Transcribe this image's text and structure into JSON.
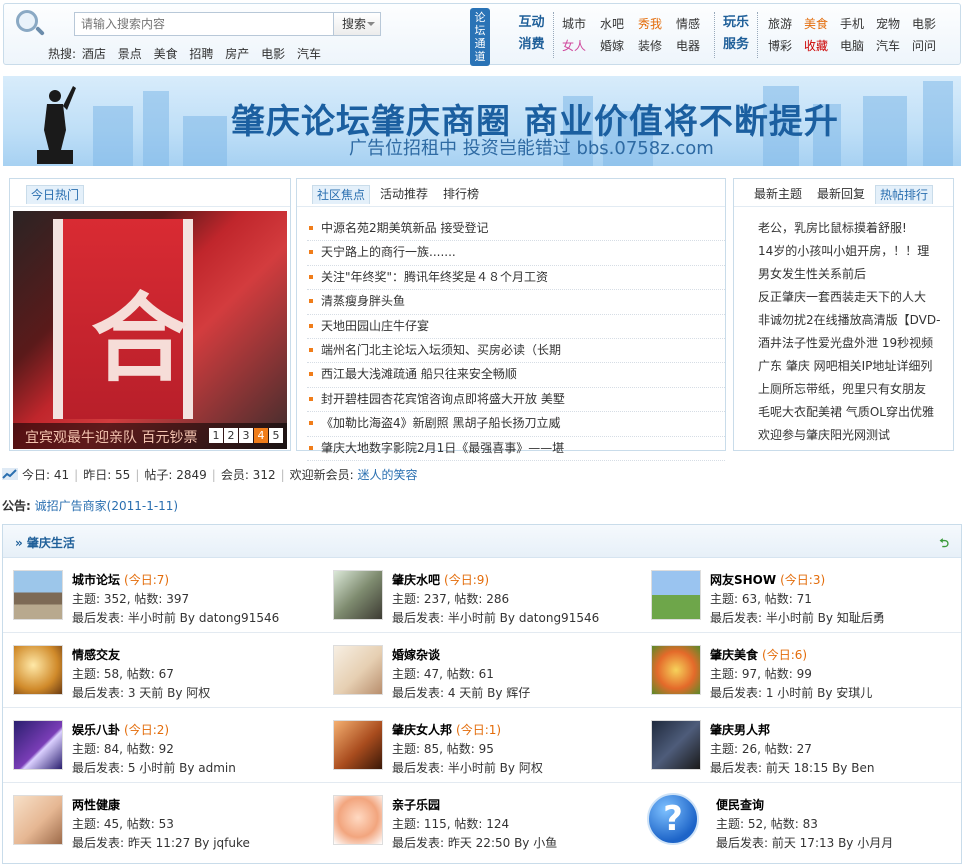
{
  "search": {
    "placeholder": "请输入搜索内容",
    "button": "搜索",
    "hot_label": "热搜:",
    "hot_words": [
      "酒店",
      "景点",
      "美食",
      "招聘",
      "房产",
      "电影",
      "汽车"
    ]
  },
  "channel": {
    "badge": "论坛通道",
    "group1": {
      "cat1": "互动",
      "cat2": "消费",
      "row1": [
        "城市",
        "水吧",
        "秀我",
        "情感"
      ],
      "row2": [
        "女人",
        "婚嫁",
        "装修",
        "电器"
      ]
    },
    "group2": {
      "cat1": "玩乐",
      "cat2": "服务",
      "row1": [
        "旅游",
        "美食",
        "手机",
        "宠物",
        "电影"
      ],
      "row2": [
        "博彩",
        "收藏",
        "电脑",
        "汽车",
        "问问"
      ]
    }
  },
  "banner": {
    "title": "肇庆论坛肇庆商圈 商业价值将不断提升",
    "subtitle": "广告位招租中  投资岂能错过  bbs.0758z.com"
  },
  "panel_left": {
    "tab": "今日热门",
    "photo_char": "合",
    "caption": "宜宾观最牛迎亲队 百元钞票",
    "pages": [
      "1",
      "2",
      "3",
      "4",
      "5"
    ],
    "active_page": "4"
  },
  "panel_mid": {
    "tabs": [
      "社区焦点",
      "活动推荐",
      "排行榜"
    ],
    "news": [
      "中源名苑2期美筑新品 接受登记",
      "天宁路上的商行一族.......",
      "关注\"年终奖\"：腾讯年终奖是４８个月工资",
      "清蒸瘦身胖头鱼",
      "天地田园山庄牛仔宴",
      "端州名门北主论坛入坛须知、买房必读（长期",
      "西江最大浅滩疏通 船只往来安全畅顺",
      "封开碧桂园杏花宾馆咨询点即将盛大开放 美墅",
      "《加勒比海盗4》新剧照 黑胡子船长扬刀立威",
      "肇庆大地数字影院2月1日《最强喜事》——堪"
    ]
  },
  "panel_right": {
    "tabs": [
      "最新主题",
      "最新回复",
      "热帖排行"
    ],
    "items": [
      "老公，乳房比鼠标摸着舒服!",
      "14岁的小孩叫小姐开房，！！理",
      "男女发生性关系前后",
      "反正肇庆一套西装走天下的人大",
      "非诚勿扰2在线播放高清版【DVD-",
      "酒井法子性爱光盘外泄 19秒视频",
      "广东 肇庆 网吧相关IP地址详细列",
      "上厕所忘带纸，兜里只有女朋友",
      "毛呢大衣配美裙 气质OL穿出优雅",
      "欢迎参与肇庆阳光网测试"
    ]
  },
  "stats": {
    "today": "今日: 41",
    "yesterday": "昨日: 55",
    "posts": "帖子: 2849",
    "members": "会员: 312",
    "welcome": "欢迎新会员:",
    "new_member": "迷人的笑容"
  },
  "notice": {
    "label": "公告:",
    "text": "诚招广告商家(2011-1-11)"
  },
  "forum": {
    "title": "» 肇庆生活",
    "collapse_icon": "double-chevron-up-icon",
    "boards": [
      {
        "name": "城市论坛",
        "today": "(今日:7)",
        "stats": "主题: 352, 帖数: 397",
        "last": "最后发表: 半小时前 By datong91546",
        "icon": "gate-photo"
      },
      {
        "name": "肇庆水吧",
        "today": "(今日:9)",
        "stats": "主题: 237, 帖数: 286",
        "last": "最后发表: 半小时前 By datong91546",
        "icon": "people-photo"
      },
      {
        "name": "网友SHOW",
        "today": "(今日:3)",
        "stats": "主题: 63, 帖数: 71",
        "last": "最后发表: 半小时前 By 知耻后勇",
        "icon": "picnic-photo"
      },
      {
        "name": "情感交友",
        "today": "",
        "stats": "主题: 58, 帖数: 67",
        "last": "最后发表: 3 天前 By 阿权",
        "icon": "lamp-photo"
      },
      {
        "name": "婚嫁杂谈",
        "today": "",
        "stats": "主题: 47, 帖数: 61",
        "last": "最后发表: 4 天前 By 辉仔",
        "icon": "bride-photo"
      },
      {
        "name": "肇庆美食",
        "today": "(今日:6)",
        "stats": "主题: 97, 帖数: 99",
        "last": "最后发表: 1 小时前 By 安琪儿",
        "icon": "food-photo"
      },
      {
        "name": "娱乐八卦",
        "today": "(今日:2)",
        "stats": "主题: 84, 帖数: 92",
        "last": "最后发表: 5 小时前 By admin",
        "icon": "lightning-photo"
      },
      {
        "name": "肇庆女人邦",
        "today": "(今日:1)",
        "stats": "主题: 85, 帖数: 95",
        "last": "最后发表: 半小时前 By 阿权",
        "icon": "women-photo"
      },
      {
        "name": "肇庆男人邦",
        "today": "",
        "stats": "主题: 26, 帖数: 27",
        "last": "最后发表: 前天 18:15 By Ben",
        "icon": "man-photo"
      },
      {
        "name": "两性健康",
        "today": "",
        "stats": "主题: 45, 帖数: 53",
        "last": "最后发表: 昨天 11:27 By jqfuke",
        "icon": "couple-photo"
      },
      {
        "name": "亲子乐园",
        "today": "",
        "stats": "主题: 115, 帖数: 124",
        "last": "最后发表: 昨天 22:50 By 小鱼",
        "icon": "baby-photo"
      },
      {
        "name": "便民查询",
        "today": "",
        "stats": "主题: 52, 帖数: 83",
        "last": "最后发表: 前天 17:13 By 小月月",
        "icon": "help-question-icon"
      }
    ]
  }
}
